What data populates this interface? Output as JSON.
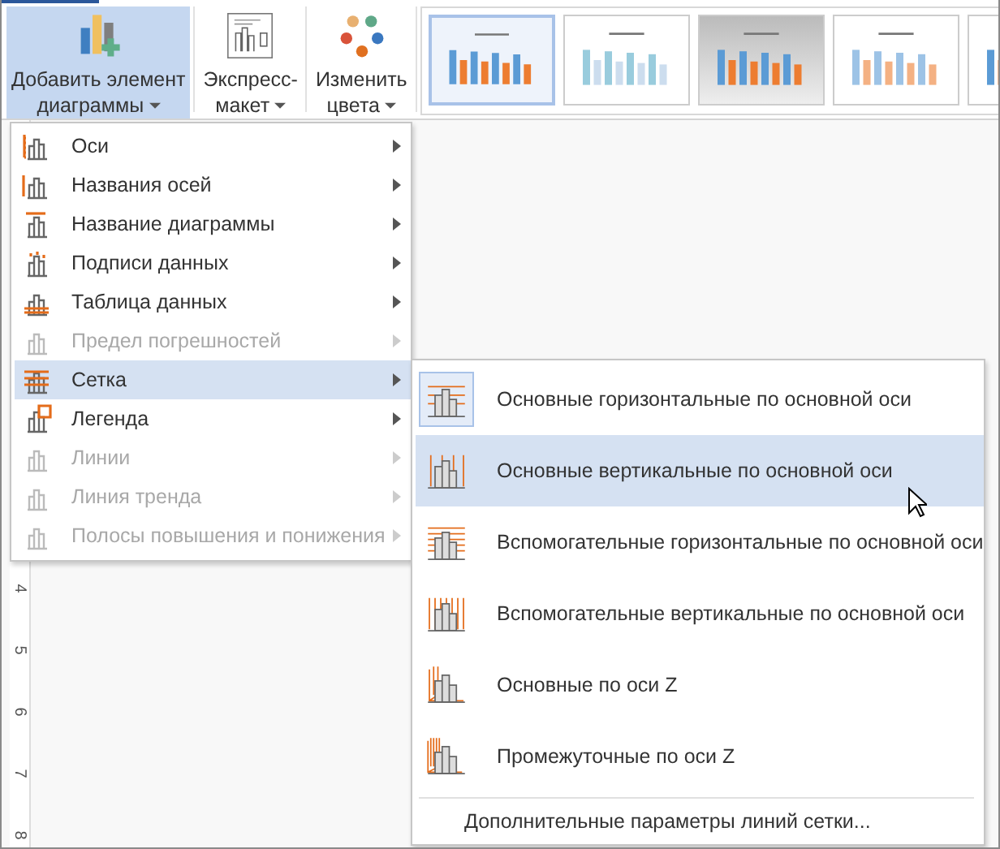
{
  "ribbon": {
    "buttons": [
      {
        "lines": [
          "Добавить элемент",
          "диаграммы"
        ],
        "selected": true,
        "has_dropdown": true
      },
      {
        "lines": [
          "Экспресс-",
          "макет"
        ],
        "selected": false,
        "has_dropdown": true
      },
      {
        "lines": [
          "Изменить",
          "цвета"
        ],
        "selected": false,
        "has_dropdown": true
      }
    ],
    "style_gallery": [
      {
        "selected": true
      },
      {
        "selected": false
      },
      {
        "selected": false
      },
      {
        "selected": false
      },
      {
        "selected": false
      }
    ]
  },
  "ruler": {
    "numbers": [
      "4",
      "5",
      "6",
      "7",
      "8"
    ]
  },
  "menu": {
    "items": [
      {
        "label": "Оси",
        "disabled": false,
        "selected": false
      },
      {
        "label": "Названия осей",
        "disabled": false,
        "selected": false
      },
      {
        "label": "Название диаграммы",
        "disabled": false,
        "selected": false
      },
      {
        "label": "Подписи данных",
        "disabled": false,
        "selected": false
      },
      {
        "label": "Таблица данных",
        "disabled": false,
        "selected": false
      },
      {
        "label": "Предел погрешностей",
        "disabled": true,
        "selected": false
      },
      {
        "label": "Сетка",
        "disabled": false,
        "selected": true
      },
      {
        "label": "Легенда",
        "disabled": false,
        "selected": false
      },
      {
        "label": "Линии",
        "disabled": true,
        "selected": false
      },
      {
        "label": "Линия тренда",
        "disabled": true,
        "selected": false
      },
      {
        "label": "Полосы повышения и понижения",
        "disabled": true,
        "selected": false
      }
    ]
  },
  "submenu": {
    "items": [
      {
        "label": "Основные горизонтальные по основной оси",
        "checked": true,
        "selected": false
      },
      {
        "label": "Основные вертикальные по основной оси",
        "checked": false,
        "selected": true
      },
      {
        "label": "Вспомогательные горизонтальные по основной оси",
        "checked": false,
        "selected": false
      },
      {
        "label": "Вспомогательные вертикальные по основной оси",
        "checked": false,
        "selected": false
      },
      {
        "label": "Основные по оси Z",
        "checked": false,
        "selected": false
      },
      {
        "label": "Промежуточные по оси Z",
        "checked": false,
        "selected": false
      }
    ],
    "more": "Дополнительные параметры линий сетки..."
  }
}
